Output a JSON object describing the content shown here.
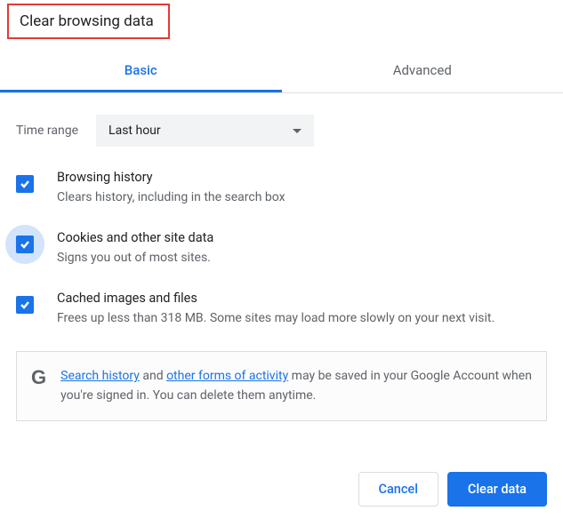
{
  "title": "Clear browsing data",
  "tabs": {
    "basic": "Basic",
    "advanced": "Advanced"
  },
  "time_range": {
    "label": "Time range",
    "value": "Last hour"
  },
  "options": {
    "browsing": {
      "title": "Browsing history",
      "desc": "Clears history, including in the search box"
    },
    "cookies": {
      "title": "Cookies and other site data",
      "desc": "Signs you out of most sites."
    },
    "cache": {
      "title": "Cached images and files",
      "desc": "Frees up less than 318 MB. Some sites may load more slowly on your next visit."
    }
  },
  "info": {
    "link1": "Search history",
    "mid1": " and ",
    "link2": "other forms of activity",
    "rest": " may be saved in your Google Account when you're signed in. You can delete them anytime."
  },
  "buttons": {
    "cancel": "Cancel",
    "clear": "Clear data"
  }
}
